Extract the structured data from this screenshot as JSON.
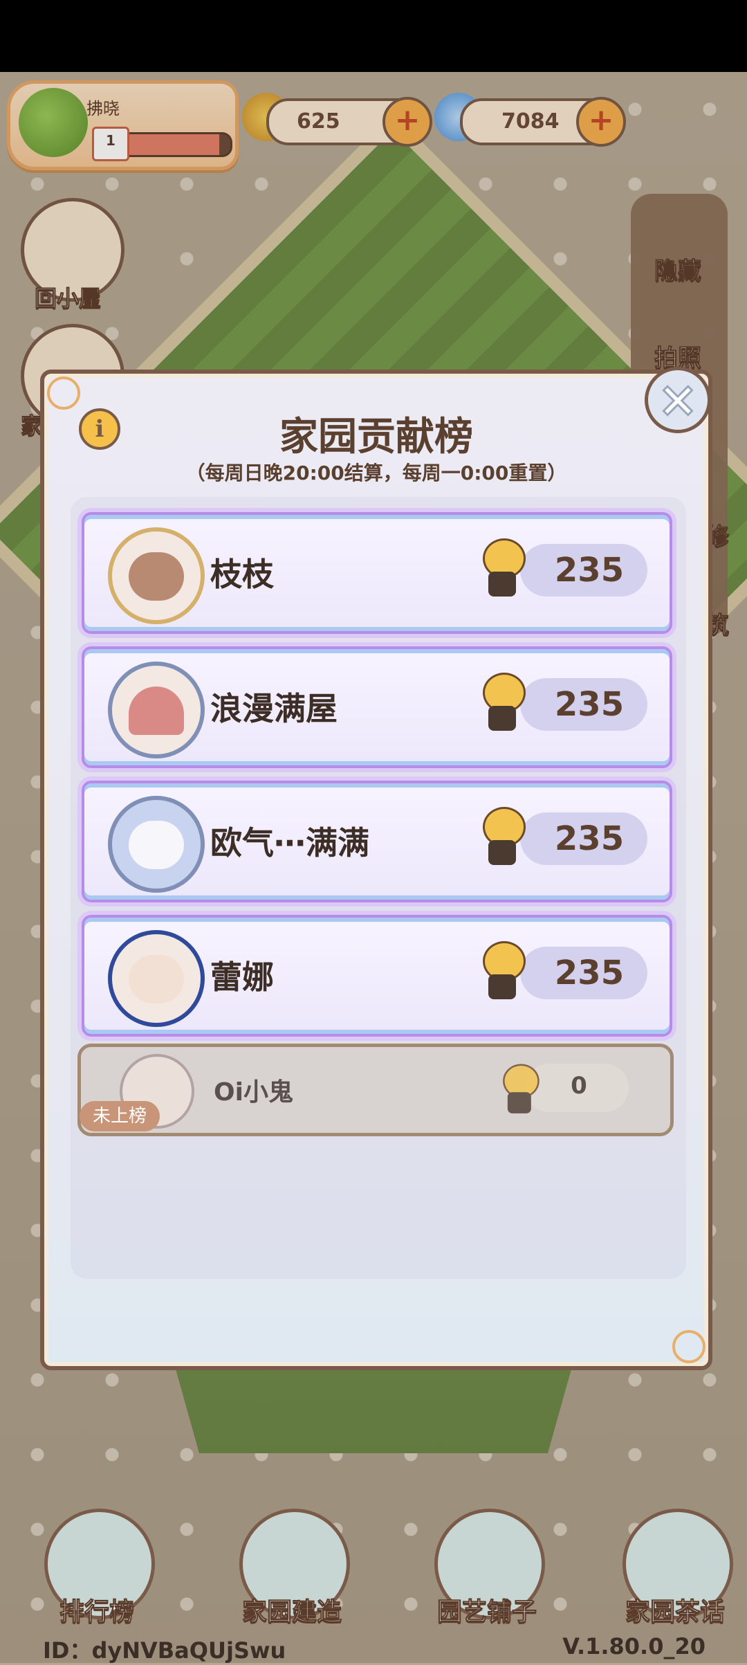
{
  "player": {
    "name": "拂晓",
    "level": "1",
    "progress": 0.9
  },
  "currencies": [
    {
      "name": "snail-coin",
      "value": "625"
    },
    {
      "name": "spiral-gem",
      "value": "7084"
    }
  ],
  "left_nav": [
    {
      "label": "回小屋"
    },
    {
      "label": "家"
    }
  ],
  "right_nav": [
    {
      "label": "隐藏"
    },
    {
      "label": "拍照"
    },
    {
      "label": "修"
    },
    {
      "label": "筑"
    }
  ],
  "modal": {
    "title": "家园贡献榜",
    "subtitle": "（每周日晚20:00结算，每周一0:00重置）",
    "info_icon": "i",
    "close_icon": "×"
  },
  "ranking": [
    {
      "name": "枝枝",
      "score": "235"
    },
    {
      "name": "浪漫满屋",
      "score": "235"
    },
    {
      "name": "欧气⋯满满",
      "score": "235"
    },
    {
      "name": "蕾娜",
      "score": "235"
    }
  ],
  "self_entry": {
    "name": "Oi小鬼",
    "score": "0",
    "badge": "未上榜"
  },
  "bottom_nav": [
    {
      "label": "排行榜"
    },
    {
      "label": "家园建造"
    },
    {
      "label": "园艺铺子"
    },
    {
      "label": "家园茶话"
    }
  ],
  "footer": {
    "id": "ID：dyNVBaQUjSwu",
    "version": "V.1.80.0_20"
  },
  "colors": {
    "modal_border": "#7a5a48",
    "row_border": "#b78be8",
    "title": "#5b4030"
  }
}
